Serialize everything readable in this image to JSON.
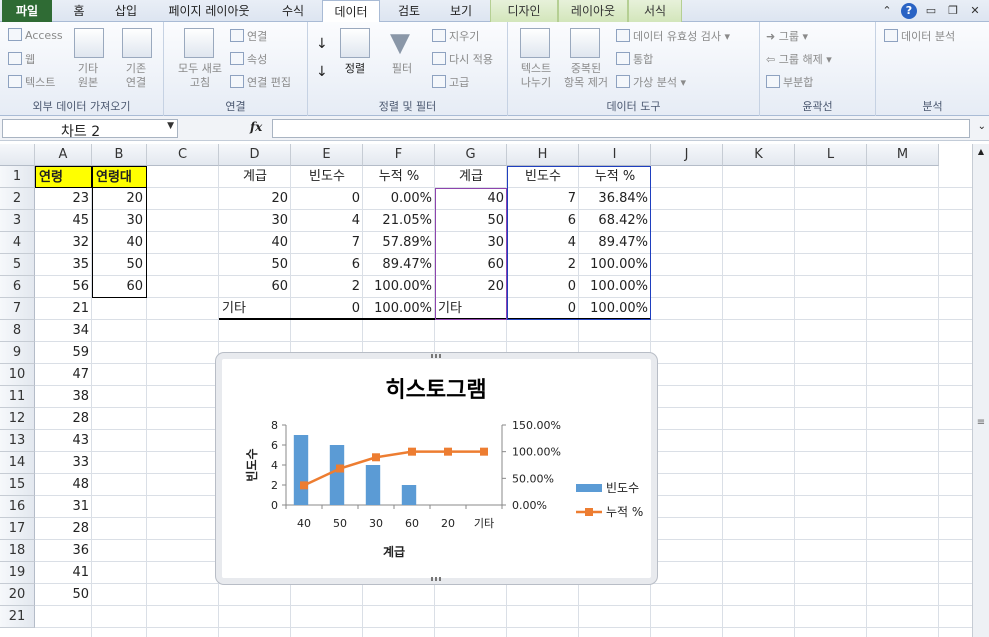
{
  "ribbon_tabs": {
    "file": "파일",
    "home": "홈",
    "insert": "삽입",
    "page_layout": "페이지 레이아웃",
    "formulas": "수식",
    "data": "데이터",
    "review": "검토",
    "view": "보기",
    "design": "디자인",
    "layout": "레이아웃",
    "format": "서식"
  },
  "ribbon": {
    "external": {
      "access": "Access",
      "web": "웹",
      "text": "텍스트",
      "other": "기타",
      "other2": "원본",
      "existing": "기존",
      "existing2": "연결",
      "group": "외부 데이터 가져오기"
    },
    "connections": {
      "refresh": "모두 새로",
      "refresh2": "고침",
      "connections": "연결",
      "properties": "속성",
      "edit_links": "연결 편집",
      "group": "연결"
    },
    "sort_filter": {
      "sort": "정렬",
      "filter": "필터",
      "clear": "지우기",
      "reapply": "다시 적용",
      "advanced": "고급",
      "group": "정렬 및 필터"
    },
    "tools": {
      "text_to_col": "텍스트",
      "text_to_col2": "나누기",
      "remove_dup": "중복된",
      "remove_dup2": "항목 제거",
      "validation": "데이터 유효성 검사",
      "consolidate": "통합",
      "whatif": "가상 분석",
      "group": "데이터 도구"
    },
    "outline": {
      "group_btn": "그룹",
      "ungroup": "그룹 해제",
      "subtotal": "부분합",
      "group": "윤곽선"
    },
    "analysis": {
      "data_analysis": "데이터 분석",
      "group": "분석"
    }
  },
  "formula_bar": {
    "name_box": "차트 2",
    "fx": "fx",
    "formula": ""
  },
  "columns": [
    "A",
    "B",
    "C",
    "D",
    "E",
    "F",
    "G",
    "H",
    "I",
    "J",
    "K",
    "L",
    "M"
  ],
  "rows": [
    "1",
    "2",
    "3",
    "4",
    "5",
    "6",
    "7",
    "8",
    "9",
    "10",
    "11",
    "12",
    "13",
    "14",
    "15",
    "16",
    "17",
    "18",
    "19",
    "20",
    "21"
  ],
  "col_a": {
    "header": "연령",
    "values": [
      "23",
      "45",
      "32",
      "35",
      "56",
      "21",
      "34",
      "59",
      "47",
      "38",
      "28",
      "43",
      "33",
      "48",
      "31",
      "28",
      "36",
      "41",
      "50"
    ]
  },
  "col_b": {
    "header": "연령대",
    "values": [
      "20",
      "30",
      "40",
      "50",
      "60"
    ]
  },
  "freq_table": {
    "headers": [
      "계급",
      "빈도수",
      "누적 %"
    ],
    "rows": [
      [
        "20",
        "0",
        "0.00%"
      ],
      [
        "30",
        "4",
        "21.05%"
      ],
      [
        "40",
        "7",
        "57.89%"
      ],
      [
        "50",
        "6",
        "89.47%"
      ],
      [
        "60",
        "2",
        "100.00%"
      ],
      [
        "기타",
        "0",
        "100.00%"
      ]
    ]
  },
  "sorted_table": {
    "headers": [
      "계급",
      "빈도수",
      "누적 %"
    ],
    "rows": [
      [
        "40",
        "7",
        "36.84%"
      ],
      [
        "50",
        "6",
        "68.42%"
      ],
      [
        "30",
        "4",
        "89.47%"
      ],
      [
        "60",
        "2",
        "100.00%"
      ],
      [
        "20",
        "0",
        "100.00%"
      ],
      [
        "기타",
        "0",
        "100.00%"
      ]
    ]
  },
  "chart_data": {
    "type": "bar",
    "title": "히스토그램",
    "xlabel": "계급",
    "ylabel": "빈도수",
    "categories": [
      "40",
      "50",
      "30",
      "60",
      "20",
      "기타"
    ],
    "series": [
      {
        "name": "빈도수",
        "type": "bar",
        "axis": "left",
        "values": [
          7,
          6,
          4,
          2,
          0,
          0
        ],
        "color": "#5b9bd5"
      },
      {
        "name": "누적 %",
        "type": "line",
        "axis": "right",
        "values": [
          36.84,
          68.42,
          89.47,
          100,
          100,
          100
        ],
        "color": "#ed7d31"
      }
    ],
    "ylim": [
      0,
      8
    ],
    "yticks": [
      "0",
      "2",
      "4",
      "6",
      "8"
    ],
    "y2lim": [
      0,
      150
    ],
    "y2ticks": [
      "0.00%",
      "50.00%",
      "100.00%",
      "150.00%"
    ],
    "legend": "right",
    "grid": false
  }
}
